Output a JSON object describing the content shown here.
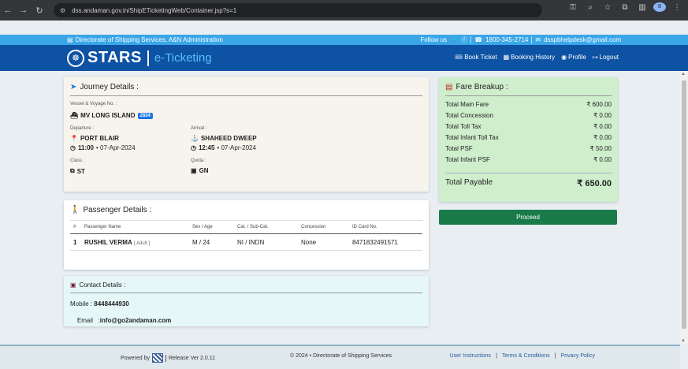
{
  "browser": {
    "url": "dss.andaman.gov.in/ShipETicketingWeb/Container.jsp?s=1",
    "profile_initial": "8"
  },
  "topbar": {
    "org": "Directorate of Shipping Services, A&N Administration",
    "follow": "Follow us",
    "phone": "1800-345-2714",
    "email": "dsspbhelpdesk@gmail.com"
  },
  "header": {
    "logo_main": "STARS",
    "logo_sub": "e-Ticketing",
    "menu": [
      {
        "label": "Book Ticket"
      },
      {
        "label": "Booking History"
      },
      {
        "label": "Profile"
      },
      {
        "label": "Logout"
      }
    ]
  },
  "journey": {
    "title": "Journey Details :",
    "vessel_label": "Vessel & Voyage No. :",
    "vessel": "MV LONG ISLAND",
    "voyage": "2834",
    "departure_label": "Departure :",
    "departure_port": "PORT BLAIR",
    "departure_time": "11:00",
    "departure_date": "• 07-Apr-2024",
    "arrival_label": "Arrival :",
    "arrival_port": "SHAHEED DWEEP",
    "arrival_time": "12:45",
    "arrival_date": "• 07-Apr-2024",
    "class_label": "Class :",
    "class": "ST",
    "quota_label": "Quota :",
    "quota": "GN"
  },
  "passenger": {
    "title": "Passenger Details :",
    "headers": [
      "#",
      "Passenger Name",
      "Sex / Age",
      "Cat. / Sub-Cat.",
      "Concession",
      "ID Card No."
    ],
    "rows": [
      {
        "num": "1",
        "name": "RUSHIL VERMA",
        "type": "[ Adult ]",
        "sex_age": "M / 24",
        "cat": "NI / INDN",
        "concession": "None",
        "id": "8471832491571"
      }
    ]
  },
  "contact": {
    "title": "Contact Details :",
    "mobile_label": "Mobile :",
    "mobile": "8448444930",
    "email_label": "Email   :",
    "email": "info@go2andaman.com"
  },
  "fare": {
    "title": "Fare Breakup :",
    "rows": [
      {
        "label": "Total Main Fare",
        "value": "₹ 600.00"
      },
      {
        "label": "Total Concession",
        "value": "₹ 0.00"
      },
      {
        "label": "Total Toll Tax",
        "value": "₹ 0.00"
      },
      {
        "label": "Total Infant Toll Tax",
        "value": "₹ 0.00"
      },
      {
        "label": "Total PSF",
        "value": "₹ 50.00"
      },
      {
        "label": "Total Infant PSF",
        "value": "₹ 0.00"
      }
    ],
    "total_label": "Total Payable",
    "total_value": "₹ 650.00"
  },
  "proceed_label": "Proceed",
  "footer": {
    "powered": "Powered by",
    "release": "Release Ver 2.0.11",
    "copyright": "© 2024 • Directorate of Shipping Services",
    "links": [
      {
        "label": "User Instructions"
      },
      {
        "label": "Terms & Conditions"
      },
      {
        "label": "Privacy Policy"
      }
    ]
  },
  "colors": {
    "topbar": "#3aa6e8",
    "header": "#0d52a3",
    "fare_bg": "#cfeecc",
    "proceed": "#197b4a"
  }
}
